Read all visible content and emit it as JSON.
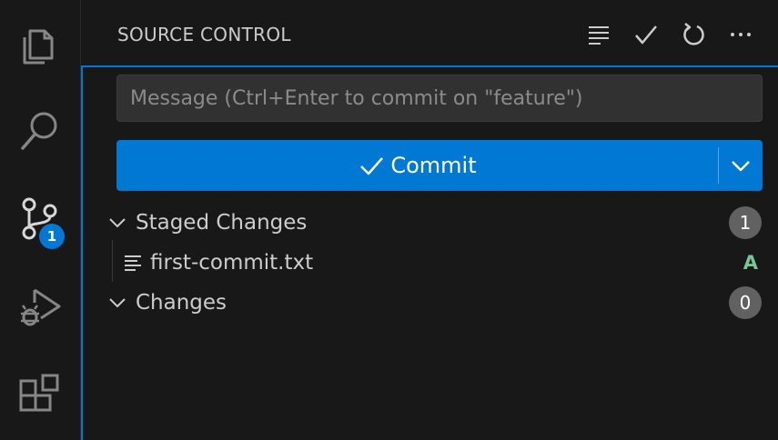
{
  "activity_bar": {
    "items": [
      {
        "icon": "files-icon",
        "label": "Explorer"
      },
      {
        "icon": "search-icon",
        "label": "Search"
      },
      {
        "icon": "source-control-icon",
        "label": "Source Control"
      },
      {
        "icon": "run-debug-icon",
        "label": "Run and Debug"
      },
      {
        "icon": "extensions-icon",
        "label": "Extensions"
      }
    ],
    "scm_badge": "1"
  },
  "header": {
    "title": "SOURCE CONTROL",
    "actions": [
      "view-as-tree-icon",
      "commit-check-icon",
      "refresh-icon",
      "more-actions-icon"
    ]
  },
  "scm": {
    "message_placeholder": "Message (Ctrl+Enter to commit on \"feature\")",
    "message_value": "",
    "commit_label": "Commit",
    "groups": [
      {
        "label": "Staged Changes",
        "count": "1",
        "files": [
          {
            "name": "first-commit.txt",
            "status": "A"
          }
        ]
      },
      {
        "label": "Changes",
        "count": "0",
        "files": []
      }
    ]
  },
  "colors": {
    "accent": "#0078d4",
    "background": "#181818",
    "added": "#73c991",
    "badge_gray": "#616161"
  }
}
